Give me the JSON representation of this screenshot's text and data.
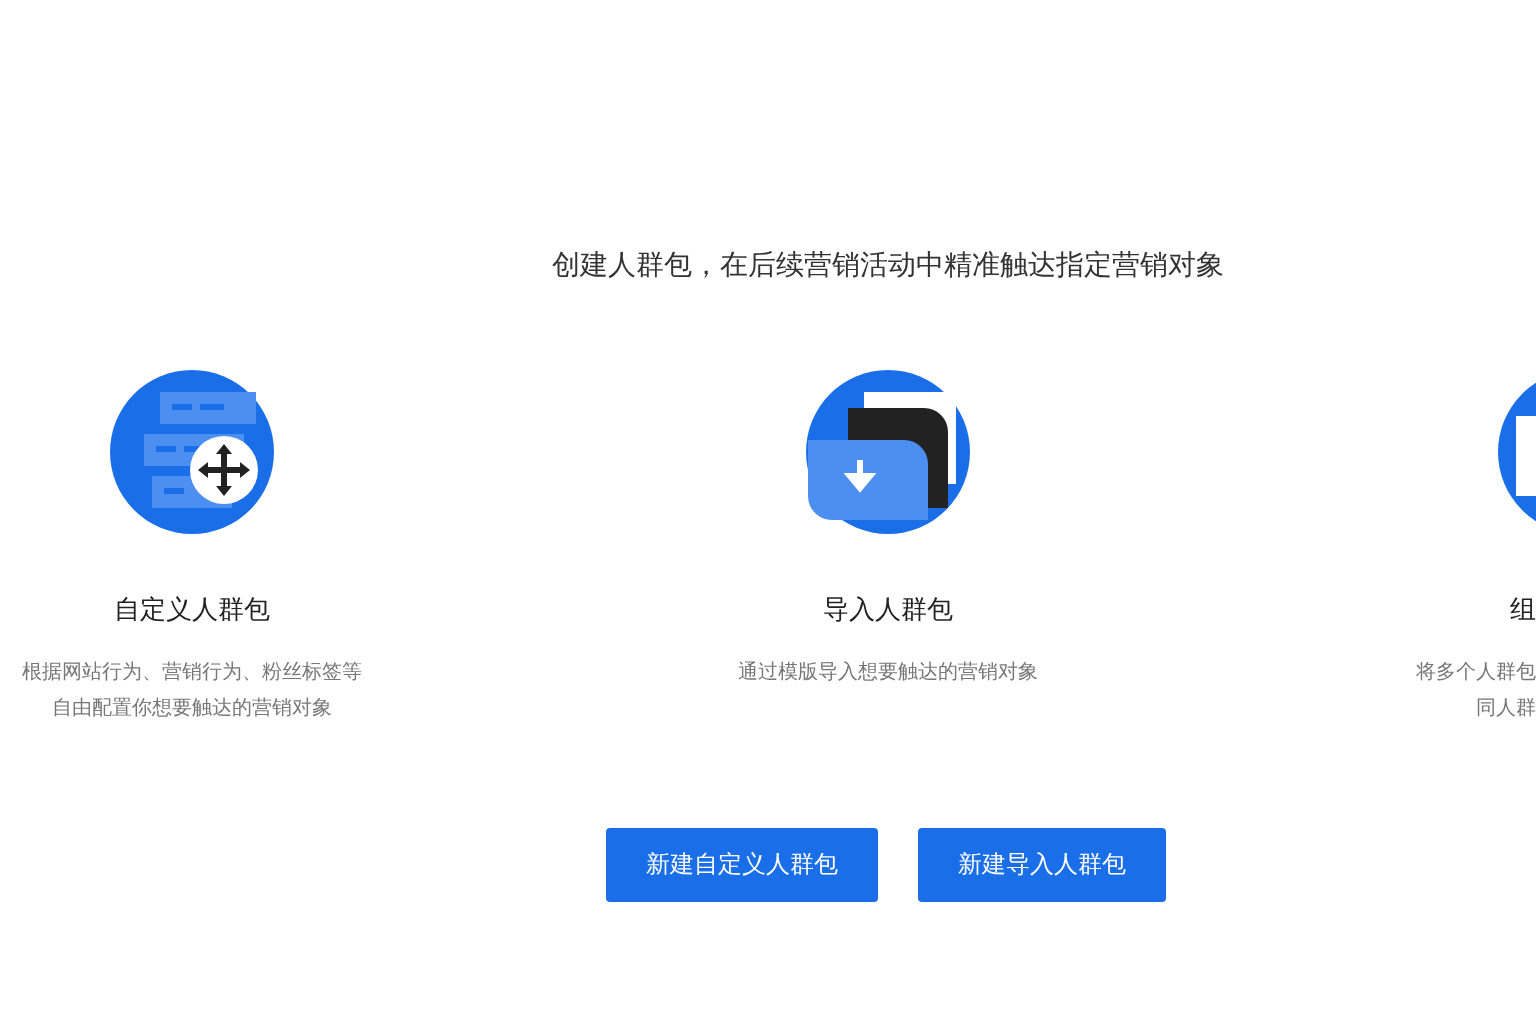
{
  "headline": "创建人群包，在后续营销活动中精准触达指定营销对象",
  "options": [
    {
      "kind": "custom",
      "title": "自定义人群包",
      "description": [
        "根据网站行为、营销行为、粉丝标签等",
        "自由配置你想要触达的营销对象"
      ]
    },
    {
      "kind": "import",
      "title": "导入人群包",
      "description": [
        "通过模版导入想要触达的营销对象"
      ]
    },
    {
      "kind": "combine",
      "title": "组",
      "description": [
        "将多个人群包",
        "同人群"
      ]
    }
  ],
  "buttons": [
    "新建自定义人群包",
    "新建导入人群包"
  ]
}
